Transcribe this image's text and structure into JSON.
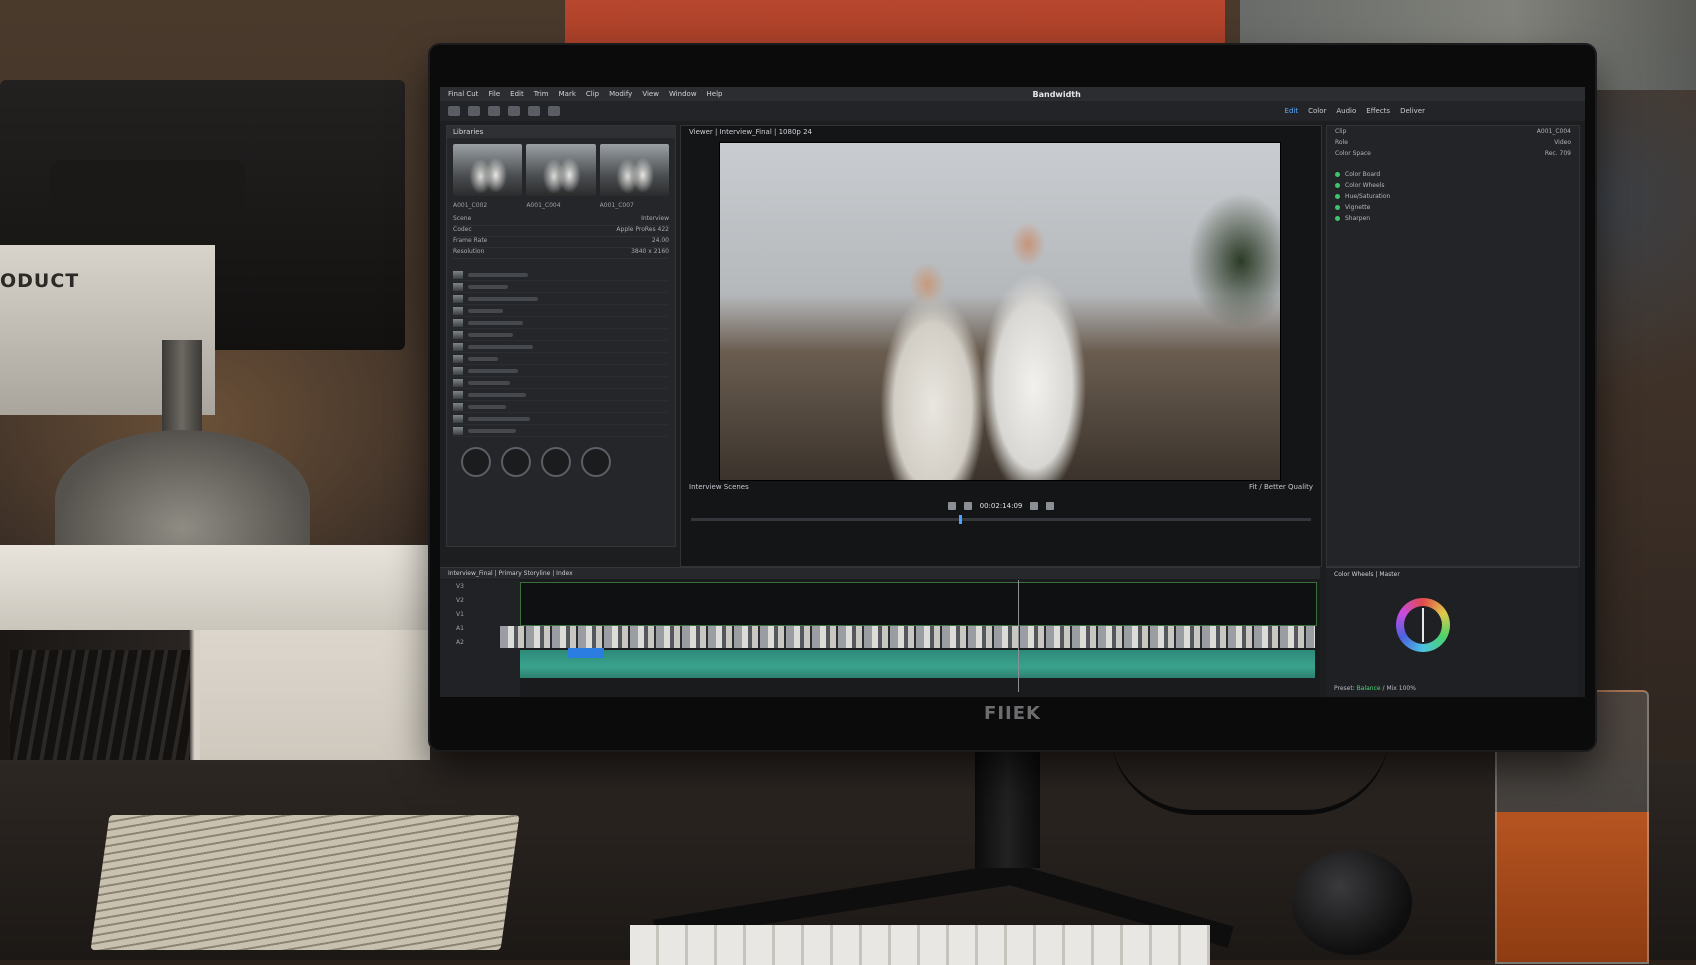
{
  "scene": {
    "recorder_label": "ODUCT",
    "monitor_brand": "FIIEK"
  },
  "app": {
    "project_title": "Bandwidth",
    "menus": [
      "Final Cut",
      "File",
      "Edit",
      "Trim",
      "Mark",
      "Clip",
      "Modify",
      "View",
      "Window",
      "Help"
    ],
    "workspace_tabs": [
      {
        "label": "Edit",
        "active": true
      },
      {
        "label": "Color",
        "active": false
      },
      {
        "label": "Audio",
        "active": false
      },
      {
        "label": "Effects",
        "active": false
      },
      {
        "label": "Deliver",
        "active": false
      }
    ],
    "browser": {
      "header": "Libraries",
      "thumb_captions": [
        "A001_C002",
        "A001_C004",
        "A001_C007"
      ],
      "props": [
        {
          "k": "Scene",
          "v": "Interview"
        },
        {
          "k": "Codec",
          "v": "Apple ProRes 422"
        },
        {
          "k": "Frame Rate",
          "v": "24.00"
        },
        {
          "k": "Resolution",
          "v": "3840 x 2160"
        }
      ],
      "clip_count": 14
    },
    "viewer": {
      "title": "Viewer  |  Interview_Final  |  1080p  24",
      "left_caption": "Interview Scenes",
      "right_caption": "Fit / Better Quality",
      "timecode": "00:02:14:09"
    },
    "inspector": {
      "rows": [
        {
          "k": "Clip",
          "v": "A001_C004"
        },
        {
          "k": "Role",
          "v": "Video"
        },
        {
          "k": "Color Space",
          "v": "Rec. 709"
        }
      ],
      "layers": [
        "Color Board",
        "Color Wheels",
        "Hue/Saturation",
        "Vignette",
        "Sharpen"
      ]
    },
    "timeline": {
      "header": "Interview_Final  |  Primary Storyline  |  Index",
      "tracks": [
        "V3",
        "V2",
        "V1",
        "A1",
        "A2"
      ]
    },
    "color": {
      "title": "Color Wheels  |  Master",
      "footer_prefix": "Preset:",
      "footer_highlight": "Balance",
      "footer_suffix": "/ Mix 100%"
    }
  }
}
